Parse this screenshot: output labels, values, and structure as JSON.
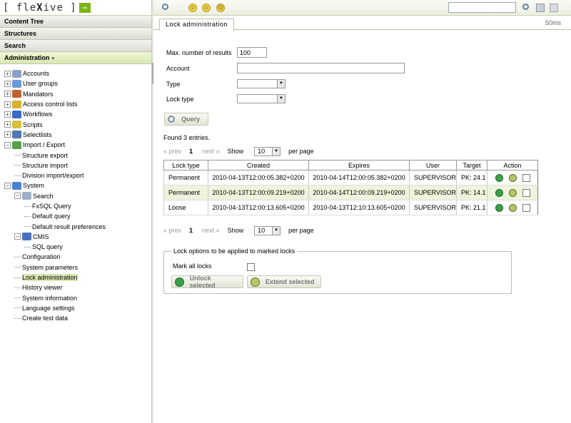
{
  "logo": {
    "prefix": "[ fle",
    "x": "X",
    "suffix": "ive ]",
    "arrow": "→"
  },
  "nav": {
    "content_tree": "Content Tree",
    "structures": "Structures",
    "search": "Search",
    "administration": "Administration",
    "administration_caret": "▾"
  },
  "tree": [
    {
      "label": "Accounts",
      "icon": "accounts-icon",
      "color": "#8aa0c8"
    },
    {
      "label": "User groups",
      "icon": "user-groups-icon",
      "color": "#6a9ad8"
    },
    {
      "label": "Mandators",
      "icon": "mandators-icon",
      "color": "#c06030"
    },
    {
      "label": "Access control lists",
      "icon": "lock-icon",
      "color": "#d8b030"
    },
    {
      "label": "Workflows",
      "icon": "workflows-icon",
      "color": "#3a68c8"
    },
    {
      "label": "Scripts",
      "icon": "scripts-icon",
      "color": "#d8c040"
    },
    {
      "label": "Selectlists",
      "icon": "selectlists-icon",
      "color": "#5078b0"
    },
    {
      "label": "Import / Export",
      "icon": "import-export-icon",
      "color": "#58a048"
    },
    {
      "label": "Structure export"
    },
    {
      "label": "Structure import"
    },
    {
      "label": "Division import/export"
    },
    {
      "label": "System",
      "icon": "system-icon",
      "color": "#4a80d0"
    },
    {
      "label": "Search",
      "icon": "search-folder-icon",
      "color": "#a0b0c8"
    },
    {
      "label": "FxSQL Query"
    },
    {
      "label": "Default query"
    },
    {
      "label": "Default result preferences"
    },
    {
      "label": "CMIS",
      "icon": "cmis-icon",
      "color": "#4a70c0"
    },
    {
      "label": "SQL query"
    },
    {
      "label": "Configuration"
    },
    {
      "label": "System parameters"
    },
    {
      "label": "Lock administration"
    },
    {
      "label": "History viewer"
    },
    {
      "label": "System information"
    },
    {
      "label": "Language settings"
    },
    {
      "label": "Create test data"
    }
  ],
  "tab": {
    "label": "Lock administration",
    "timing": "50ms"
  },
  "toolbar": {
    "search_value": ""
  },
  "form": {
    "max_results_label": "Max. number of results",
    "max_results_value": "100",
    "account_label": "Account",
    "account_value": "",
    "type_label": "Type",
    "type_value": "",
    "lock_type_label": "Lock type",
    "lock_type_value": "",
    "query_button": "Query"
  },
  "results": {
    "found": "Found 3 entries.",
    "prev": "« prev",
    "page": "1",
    "next": "next »",
    "show": "Show",
    "per_page_value": "10",
    "per_page": "per page"
  },
  "grid": {
    "columns": [
      "Lock type",
      "Created",
      "Expires",
      "User",
      "Target",
      "Action"
    ],
    "rows": [
      [
        "Permanent",
        "2010-04-13T12:00:05.382+0200",
        "2010-04-14T12:00:05.382+0200",
        "SUPERVISOR",
        "PK: 24.1"
      ],
      [
        "Permanent",
        "2010-04-13T12:00:09.219+0200",
        "2010-04-14T12:00:09.219+0200",
        "SUPERVISOR",
        "PK: 14.1"
      ],
      [
        "Loose",
        "2010-04-13T12:00:13.605+0200",
        "2010-04-13T12:10:13.605+0200",
        "SUPERVISOR",
        "PK: 21.1"
      ]
    ]
  },
  "lock_options": {
    "legend": "Lock options to be applied to marked locks",
    "mark_all": "Mark all locks",
    "unlock_button": "Unlock selected",
    "extend_button": "Extend selected"
  },
  "colors": {
    "accent_green": "#7cb518",
    "selected_row": "#eef3dc"
  }
}
